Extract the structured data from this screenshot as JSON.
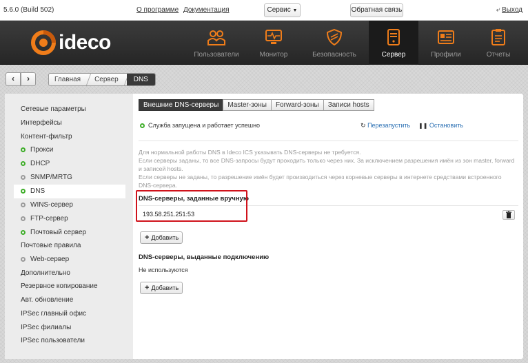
{
  "topbar": {
    "version": "5.6.0 (Build 502)",
    "about_link": "О программе",
    "docs_link": "Документация",
    "service_button": "Сервис",
    "feedback_button": "Обратная связь",
    "exit_link": "Выход"
  },
  "logo": {
    "text": "ideco"
  },
  "nav": [
    {
      "label": "Пользователи",
      "icon": "users-icon"
    },
    {
      "label": "Монитор",
      "icon": "monitor-icon"
    },
    {
      "label": "Безопасность",
      "icon": "shield-icon"
    },
    {
      "label": "Сервер",
      "icon": "server-icon"
    },
    {
      "label": "Профили",
      "icon": "profiles-icon"
    },
    {
      "label": "Отчеты",
      "icon": "reports-icon"
    }
  ],
  "breadcrumb": [
    "Главная",
    "Сервер",
    "DNS"
  ],
  "sidebar": [
    {
      "label": "Сетевые параметры"
    },
    {
      "label": "Интерфейсы"
    },
    {
      "label": "Контент-фильтр"
    },
    {
      "label": "Прокси"
    },
    {
      "label": "DHCP"
    },
    {
      "label": "SNMP/MRTG"
    },
    {
      "label": "DNS"
    },
    {
      "label": "WINS-сервер"
    },
    {
      "label": "FTP-сервер"
    },
    {
      "label": "Почтовый сервер"
    },
    {
      "label": "Почтовые правила"
    },
    {
      "label": "Web-сервер"
    },
    {
      "label": "Дополнительно"
    },
    {
      "label": "Резервное копирование"
    },
    {
      "label": "Авт. обновление"
    },
    {
      "label": "IPSec главный офис"
    },
    {
      "label": "IPSec филиалы"
    },
    {
      "label": "IPSec пользователи"
    }
  ],
  "tabs": [
    "Внешние DNS-серверы",
    "Master-зоны",
    "Forward-зоны",
    "Записи hosts"
  ],
  "status": {
    "text": "Служба запущена и работает успешно",
    "restart": "Перезапустить",
    "stop": "Остановить"
  },
  "info_lines": [
    "Для нормальной работы DNS в Ideco ICS указывать DNS-серверы не требуется.",
    "Если серверы заданы, то все DNS-запросы будут проходить только через них. За исключением разрешения имён из зон master, forward",
    "и записей hosts.",
    "Если серверы не заданы, то разрешение имён будет производиться через корневые серверы в интернете средствами встроенного",
    "DNS-сервера."
  ],
  "manual": {
    "title": "DNS-серверы, заданные вручную",
    "value": "193.58.251.251:53",
    "add": "Добавить"
  },
  "issued": {
    "title": "DNS-серверы, выданные подключению",
    "value": "Не используются",
    "add": "Добавить"
  }
}
